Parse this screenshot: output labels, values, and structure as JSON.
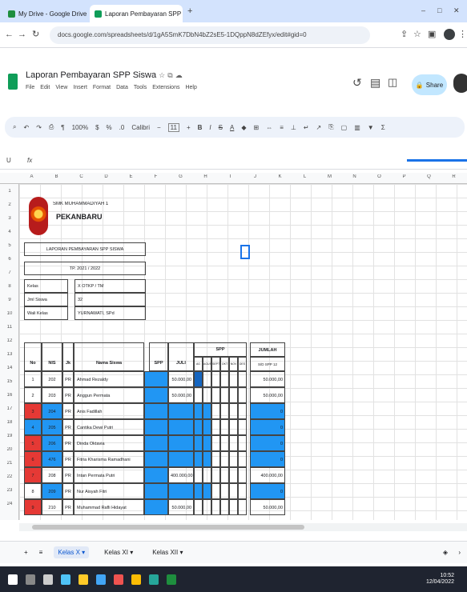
{
  "browser": {
    "tabs": [
      {
        "label": "My Drive - Google Drive"
      },
      {
        "label": "Laporan Pembayaran SPP Siswa - G"
      }
    ],
    "url": "docs.google.com/spreadsheets/d/1gA5SmK7DbN4bZ2sE5-1DQppN8dZEfyx/edit#gid=0"
  },
  "sheets": {
    "title": "Laporan Pembayaran SPP Siswa",
    "menus": [
      "File",
      "Edit",
      "View",
      "Insert",
      "Format",
      "Data",
      "Tools",
      "Extensions",
      "Help"
    ],
    "share_label": "Share",
    "font": "Calibri",
    "font_size": "11",
    "zoom": "100%",
    "cell_ref": "U",
    "columns": [
      "A",
      "B",
      "C",
      "D",
      "E",
      "F",
      "G",
      "H",
      "I",
      "J",
      "K",
      "L",
      "M",
      "N",
      "O",
      "P",
      "Q",
      "R"
    ],
    "rows": [
      "1",
      "2",
      "3",
      "4",
      "5",
      "6",
      "7",
      "8",
      "9",
      "10",
      "11",
      "12",
      "13",
      "14",
      "15",
      "16",
      "17",
      "18",
      "19",
      "20",
      "21",
      "22",
      "23",
      "24"
    ],
    "school_line1": "SMK MUHAMMADIYAH 1",
    "school_line2": "PEKANBARU",
    "report_title": "LAPORAN PEMBAYARAN SPP SISWA",
    "year": "TP. 2021 / 2022",
    "info": [
      {
        "label": "Kelas",
        "value": "X OTKP / TM"
      },
      {
        "label": "Jml Siswa",
        "value": "32"
      },
      {
        "label": "Wali Kelas",
        "value": "YURNAWATI, SPd"
      }
    ],
    "table_headers": {
      "no": "No",
      "nis": "NIS",
      "jk": "Jk",
      "nama": "Nama Siswa",
      "spp": "SPP",
      "juli": "JULI",
      "group": "SPP",
      "jumlah": "JUMLAH",
      "jumlah_sub": "S/D SPP 12"
    },
    "months": [
      "AG",
      "AGUS",
      "SEPT",
      "OKT",
      "NOV",
      "DES"
    ],
    "students": [
      {
        "no": "1",
        "nis": "202",
        "jk": "PR",
        "name": "Ahmad Rezaldy",
        "juli": "50.000,00",
        "jumlah": "50.000,00"
      },
      {
        "no": "2",
        "nis": "203",
        "jk": "PR",
        "name": "Anggun Permata",
        "juli": "50.000,00",
        "jumlah": "50.000,00"
      },
      {
        "no": "3",
        "nis": "204",
        "jk": "PR",
        "name": "Anis Fadillah",
        "juli": "",
        "jumlah": "0"
      },
      {
        "no": "4",
        "nis": "205",
        "jk": "PR",
        "name": "Cantika Dewi Putri",
        "juli": "",
        "jumlah": "0"
      },
      {
        "no": "5",
        "nis": "206",
        "jk": "PR",
        "name": "Dinda Oktavia",
        "juli": "",
        "jumlah": "0"
      },
      {
        "no": "6",
        "nis": "476",
        "jk": "PR",
        "name": "Fitria Kharisma Ramadhani",
        "juli": "",
        "jumlah": "0"
      },
      {
        "no": "7",
        "nis": "208",
        "jk": "PR",
        "name": "Intan Permata Putri",
        "juli": "400.000,00",
        "jumlah": "400.000,00"
      },
      {
        "no": "8",
        "nis": "209",
        "jk": "PR",
        "name": "Nur Aisyah Fitri",
        "juli": "",
        "jumlah": "0"
      },
      {
        "no": "9",
        "nis": "210",
        "jk": "PR",
        "name": "Muhammad Rafli Hidayat",
        "juli": "50.000,00",
        "jumlah": "50.000,00"
      }
    ],
    "sheet_tabs": [
      "Kelas X",
      "Kelas XI",
      "Kelas XII"
    ]
  },
  "taskbar": {
    "time": "10:52",
    "date": "12/04/2022"
  },
  "colors": {
    "accent": "#1a73e8",
    "cell_blue": "#2196f3",
    "cell_red": "#e53935",
    "share_bg": "#c2e7ff"
  }
}
